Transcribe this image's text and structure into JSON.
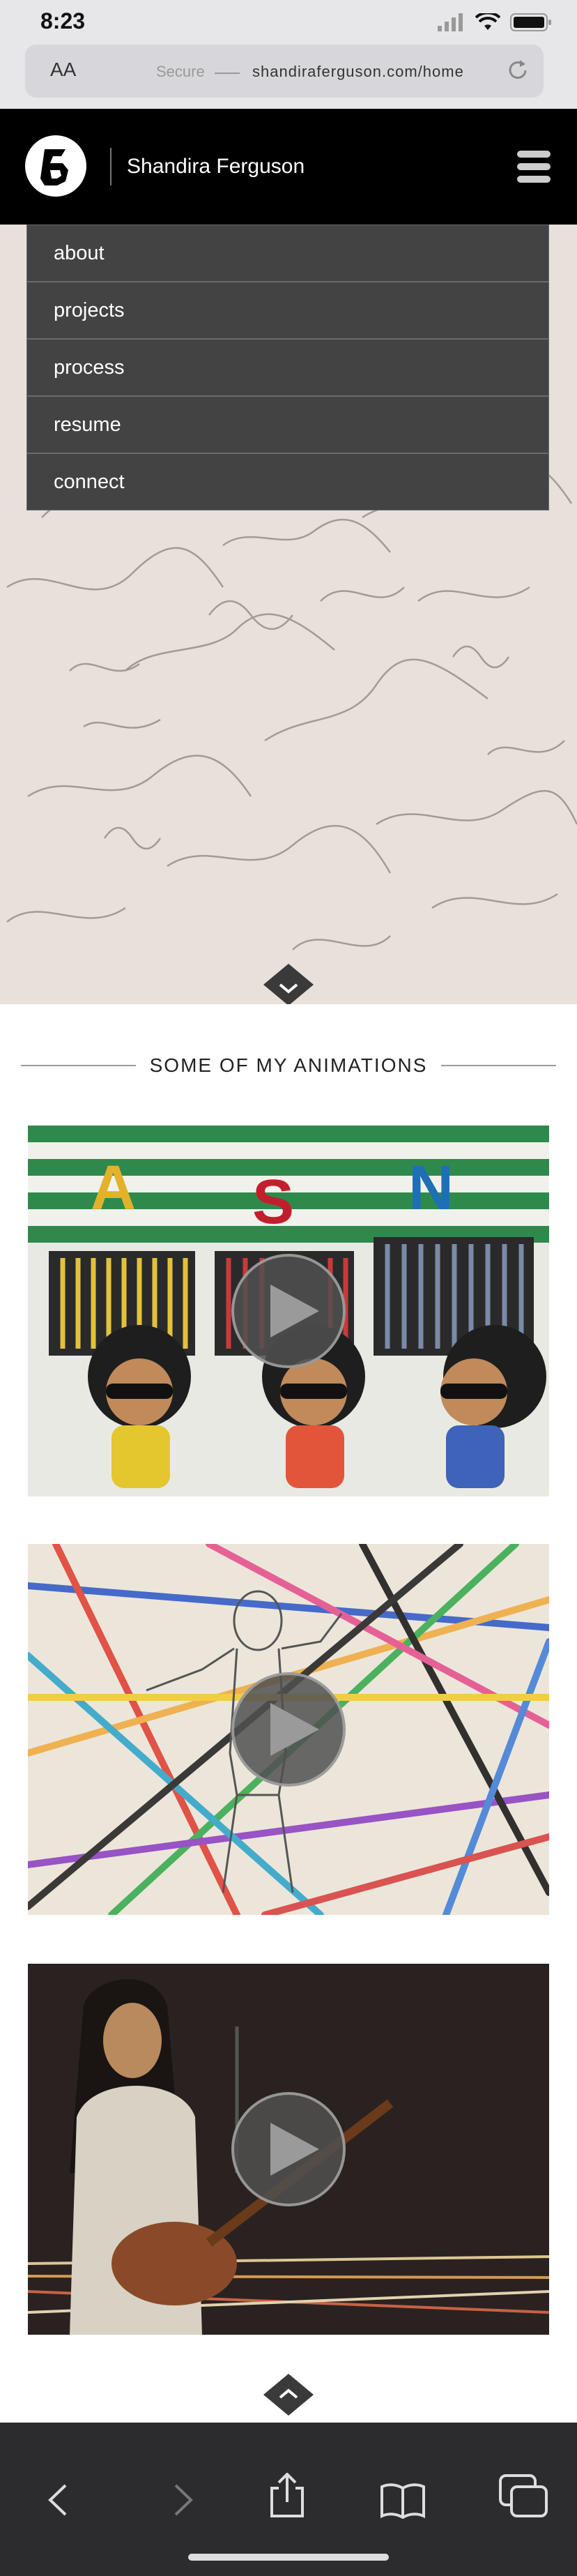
{
  "status_bar": {
    "time": "8:23"
  },
  "browser": {
    "text_size_label": "AA",
    "secure_label": "Secure",
    "url": "shandiraferguson.com/home"
  },
  "site": {
    "name": "Shandira Ferguson",
    "menu": [
      "about",
      "projects",
      "process",
      "resume",
      "connect"
    ]
  },
  "animations": {
    "title": "SOME OF MY ANIMATIONS",
    "videos": [
      {
        "name": "ASN puppets animation"
      },
      {
        "name": "dancing outline figure animation"
      },
      {
        "name": "clay guitarist animation"
      }
    ]
  },
  "colors": {
    "header_bg": "#000000",
    "menu_bg": "#434343",
    "toolbar_bg": "#2c2c2e"
  }
}
